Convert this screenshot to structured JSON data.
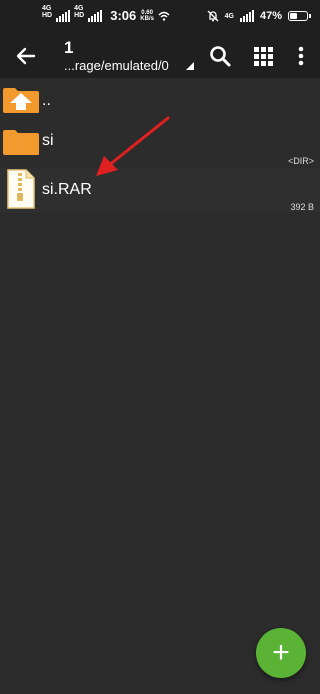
{
  "status_bar": {
    "net1": "4G",
    "net1_sub": "HD",
    "net2": "4G",
    "net2_sub": "HD",
    "time": "3:06",
    "speed_value": "0.60",
    "speed_unit": "KB/s",
    "right_net": "4G",
    "battery_text": "47%",
    "battery_level": 0.47
  },
  "toolbar": {
    "title": "1",
    "path": "...rage/emulated/0"
  },
  "files": [
    {
      "name": "..",
      "meta": ""
    },
    {
      "name": "si",
      "meta": "<DIR>"
    },
    {
      "name": "si.RAR",
      "meta": "392 B"
    }
  ],
  "fab": {
    "label": "+"
  },
  "colors": {
    "background": "#2c2c2c",
    "bar": "#1f1f1f",
    "folder": "#f29a2e",
    "fab": "#5bb336",
    "annotation_arrow": "#e02020"
  }
}
